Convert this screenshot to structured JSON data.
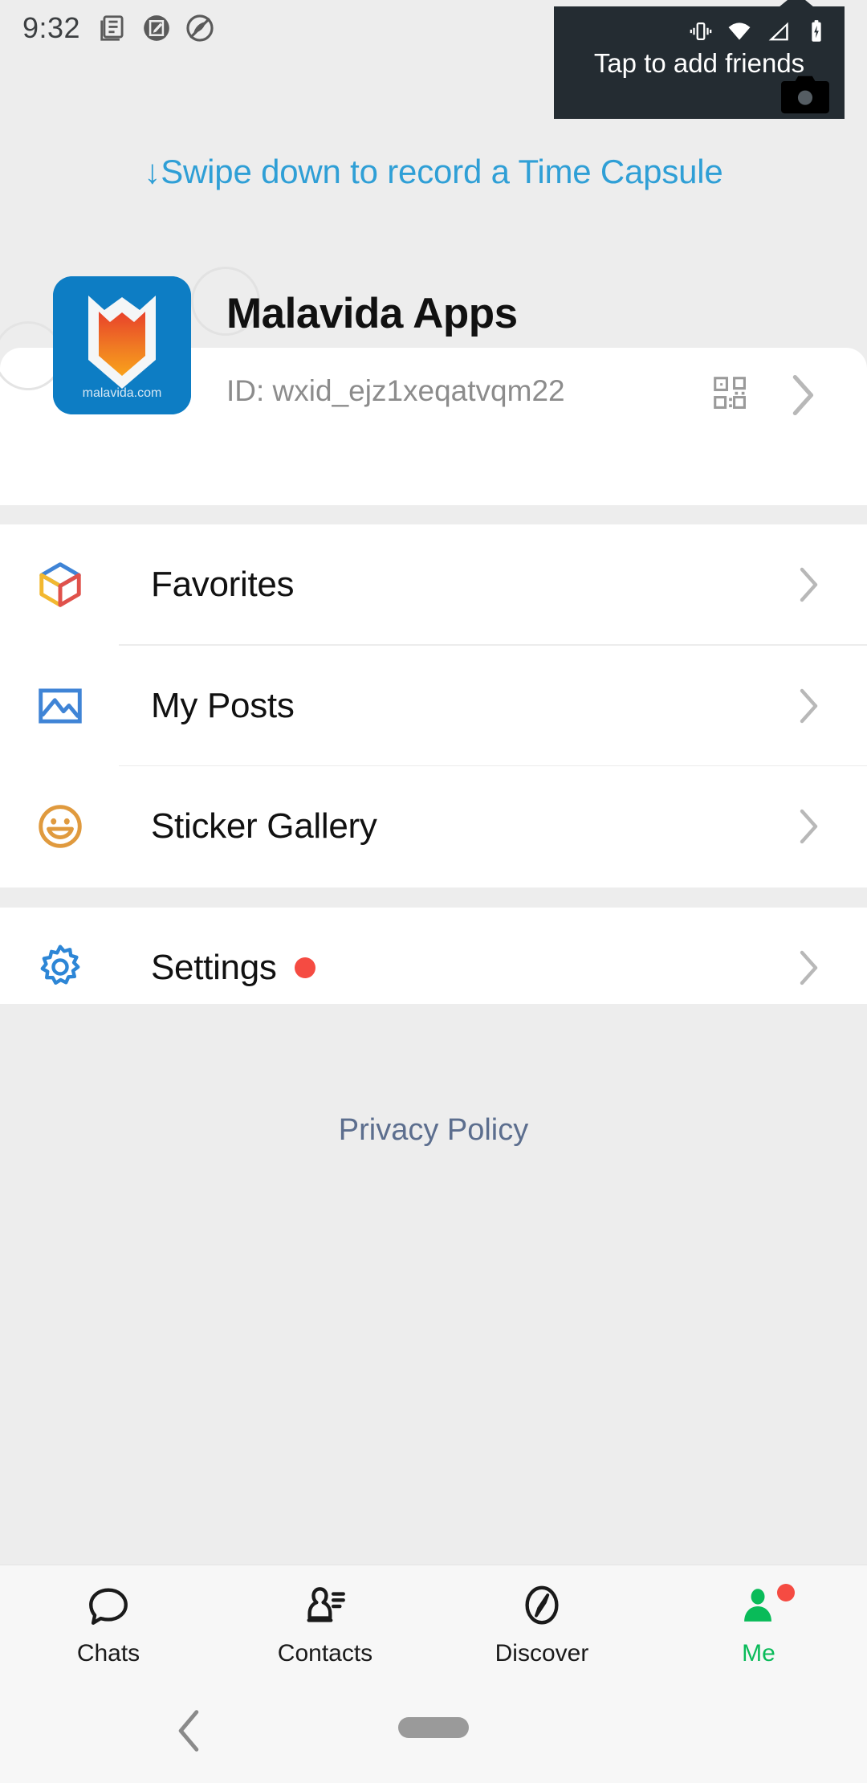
{
  "status_bar": {
    "time": "9:32",
    "left_icons": [
      "news-icon",
      "screenshot-edit-icon",
      "do-not-disturb-icon"
    ],
    "right_icons": [
      "vibrate-icon",
      "wifi-icon",
      "cellular-signal-icon",
      "battery-charging-icon"
    ]
  },
  "tooltip": {
    "text": "Tap to add friends",
    "camera_icon": "camera-icon",
    "background_color": "#242c32",
    "text_color": "#ffffff"
  },
  "swipe_hint": {
    "text": "↓Swipe down to record a Time Capsule",
    "color": "#2f9fd6"
  },
  "profile": {
    "name": "Malavida Apps",
    "id": "ID: wxid_ejz1xeqatvqm22",
    "avatar_caption": "malavida.com",
    "avatar_background": "#0d7dc4",
    "qr_icon": "qr-code-icon",
    "chevron_icon": "chevron-right-icon"
  },
  "menu_groups": [
    {
      "items": [
        {
          "label": "Favorites",
          "icon": "cube-box-icon",
          "badge": false,
          "chevron": "chevron-right-icon"
        },
        {
          "label": "My Posts",
          "icon": "photo-frame-icon",
          "badge": false,
          "chevron": "chevron-right-icon"
        },
        {
          "label": "Sticker Gallery",
          "icon": "smiley-face-icon",
          "badge": false,
          "chevron": "chevron-right-icon"
        }
      ]
    },
    {
      "items": [
        {
          "label": "Settings",
          "icon": "gear-icon",
          "badge": true,
          "chevron": "chevron-right-icon"
        }
      ]
    }
  ],
  "privacy_policy": {
    "label": "Privacy Policy",
    "color": "#5c6e8e"
  },
  "bottom_nav": {
    "active_color": "#09bb59",
    "items": [
      {
        "label": "Chats",
        "icon": "speech-bubble-icon",
        "active": false,
        "badge": false
      },
      {
        "label": "Contacts",
        "icon": "contacts-person-icon",
        "active": false,
        "badge": false
      },
      {
        "label": "Discover",
        "icon": "compass-icon",
        "active": false,
        "badge": false
      },
      {
        "label": "Me",
        "icon": "person-icon",
        "active": true,
        "badge": true
      }
    ]
  },
  "gesture_bar": {
    "back_icon": "chevron-left-icon",
    "home_indicator": "home-pill-indicator"
  }
}
